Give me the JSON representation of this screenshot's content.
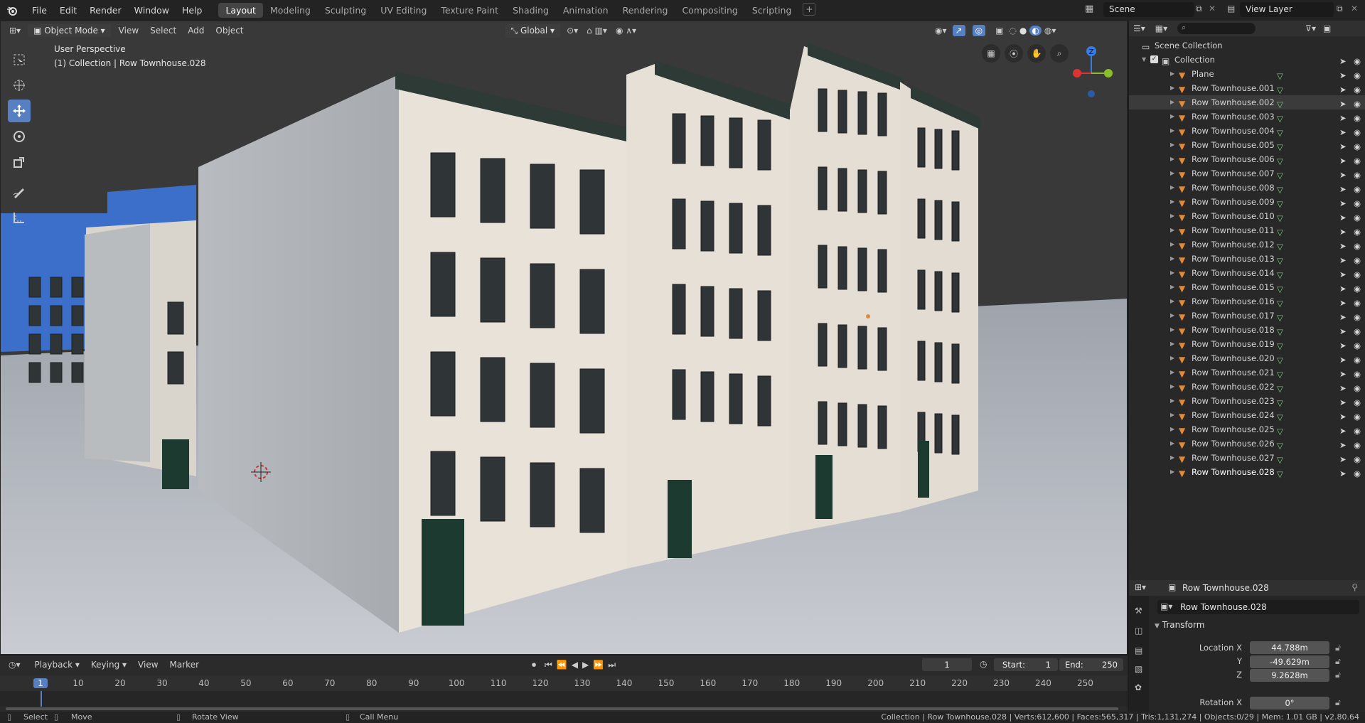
{
  "menu": [
    "File",
    "Edit",
    "Render",
    "Window",
    "Help"
  ],
  "workspaces": [
    "Layout",
    "Modeling",
    "Sculpting",
    "UV Editing",
    "Texture Paint",
    "Shading",
    "Animation",
    "Rendering",
    "Compositing",
    "Scripting"
  ],
  "scene": "Scene",
  "view_layer": "View Layer",
  "viewport_header": {
    "mode": "Object Mode",
    "view": "View",
    "select": "Select",
    "add": "Add",
    "object": "Object",
    "orientation": "Global"
  },
  "viewport_overlay": {
    "perspective": "User Perspective",
    "collection_info": "(1) Collection | Row Townhouse.028"
  },
  "gizmo": {
    "z": "Z"
  },
  "outliner": {
    "scene_collection": "Scene Collection",
    "collection": "Collection",
    "items": [
      "Plane",
      "Row Townhouse.001",
      "Row Townhouse.002",
      "Row Townhouse.003",
      "Row Townhouse.004",
      "Row Townhouse.005",
      "Row Townhouse.006",
      "Row Townhouse.007",
      "Row Townhouse.008",
      "Row Townhouse.009",
      "Row Townhouse.010",
      "Row Townhouse.011",
      "Row Townhouse.012",
      "Row Townhouse.013",
      "Row Townhouse.014",
      "Row Townhouse.015",
      "Row Townhouse.016",
      "Row Townhouse.017",
      "Row Townhouse.018",
      "Row Townhouse.019",
      "Row Townhouse.020",
      "Row Townhouse.021",
      "Row Townhouse.022",
      "Row Townhouse.023",
      "Row Townhouse.024",
      "Row Townhouse.025",
      "Row Townhouse.026",
      "Row Townhouse.027",
      "Row Townhouse.028"
    ]
  },
  "properties": {
    "object_title": "Row Townhouse.028",
    "object_name": "Row Townhouse.028",
    "panel": "Transform",
    "location_x_label": "Location X",
    "location_y_label": "Y",
    "location_z_label": "Z",
    "rotation_x_label": "Rotation X",
    "location_x": "44.788m",
    "location_y": "-49.629m",
    "location_z": "9.2628m",
    "rotation_x": "0°"
  },
  "timeline": {
    "playback": "Playback",
    "keying": "Keying",
    "view": "View",
    "marker": "Marker",
    "current_frame": "1",
    "start_label": "Start:",
    "start": "1",
    "end_label": "End:",
    "end": "250",
    "ruler": [
      "1",
      "10",
      "20",
      "30",
      "40",
      "50",
      "60",
      "70",
      "80",
      "90",
      "100",
      "110",
      "120",
      "130",
      "140",
      "150",
      "160",
      "170",
      "180",
      "190",
      "200",
      "210",
      "220",
      "230",
      "240",
      "250"
    ]
  },
  "status": {
    "select": "Select",
    "move": "Move",
    "rotate": "Rotate View",
    "call_menu": "Call Menu",
    "stats": "Collection | Row Townhouse.028 | Verts:612,600 | Faces:565,317 | Tris:1,131,274 | Objects:0/29 | Mem: 1.01 GB | v2.80.64"
  },
  "colors": {
    "accent": "#5680c2",
    "mesh_orange": "#e08a3c",
    "vert_green": "#6fcf6f"
  }
}
